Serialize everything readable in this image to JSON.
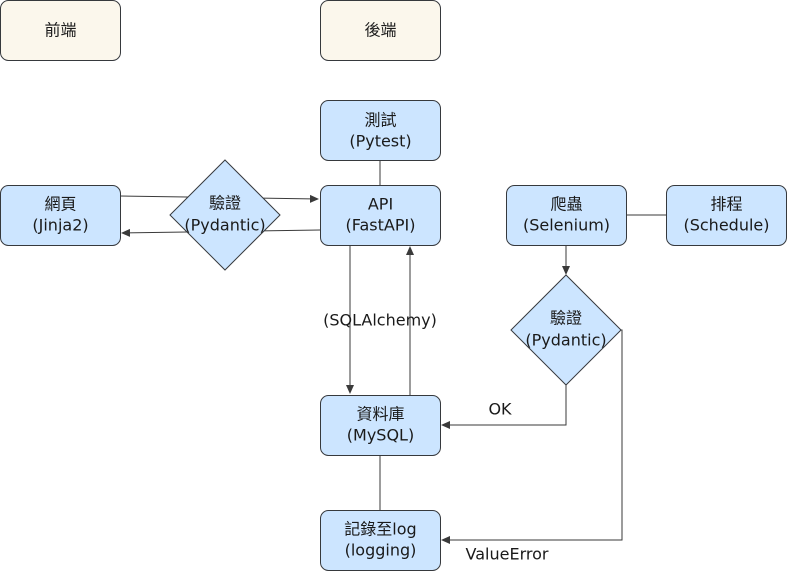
{
  "colors": {
    "header_fill": "#fbf7ec",
    "node_fill": "#cce5ff",
    "stroke": "#36393d",
    "line": "#3a3a3a"
  },
  "headers": {
    "frontend": "前端",
    "backend": "後端"
  },
  "nodes": {
    "test": {
      "line1": "測試",
      "line2": "(Pytest)"
    },
    "webpage": {
      "line1": "網頁",
      "line2": "(Jinja2)"
    },
    "api": {
      "line1": "API",
      "line2": "(FastAPI)"
    },
    "crawler": {
      "line1": "爬蟲",
      "line2": "(Selenium)"
    },
    "schedule": {
      "line1": "排程",
      "line2": "(Schedule)"
    },
    "validate_front": {
      "line1": "驗證",
      "line2": "(Pydantic)"
    },
    "validate_crawler": {
      "line1": "驗證",
      "line2": "(Pydantic)"
    },
    "database": {
      "line1": "資料庫",
      "line2": "(MySQL)"
    },
    "logging": {
      "line1": "記錄至log",
      "line2": "(logging)"
    }
  },
  "edge_labels": {
    "orm": "(SQLAlchemy)",
    "ok": "OK",
    "error": "ValueError"
  }
}
